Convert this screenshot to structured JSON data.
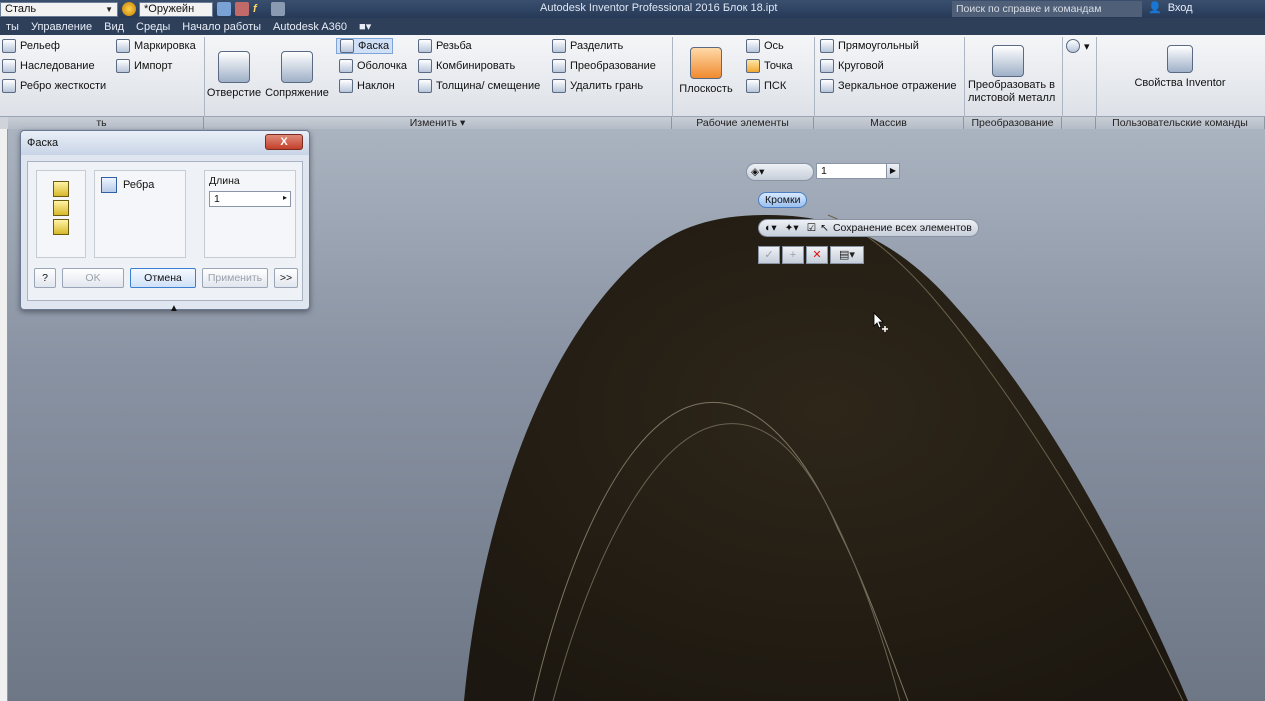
{
  "titlebar": {
    "material": "Сталь",
    "appearance": "*Оружейн",
    "title": "Autodesk Inventor Professional 2016   Блок 18.ipt",
    "help_search": "Поиск по справке и командам",
    "signin": "Вход"
  },
  "menu": {
    "items": [
      "ты",
      "Управление",
      "Вид",
      "Среды",
      "Начало работы",
      "Autodesk A360"
    ]
  },
  "ribbon": {
    "create_col": [
      "Рельеф",
      "Наследование",
      "Ребро жесткости"
    ],
    "create_col2": [
      "Маркировка",
      "Импорт"
    ],
    "hole": "Отверстие",
    "fillet": "Сопряжение",
    "modify_col1": [
      "Фаска",
      "Оболочка",
      "Наклон"
    ],
    "modify_col2": [
      "Резьба",
      "Комбинировать",
      "Толщина/ смещение"
    ],
    "modify_col3": [
      "Разделить",
      "Преобразование",
      "Удалить грань"
    ],
    "plane": "Плоскость",
    "work_col": [
      "Ось",
      "Точка",
      "ПСК"
    ],
    "pattern_col": [
      "Прямоугольный",
      "Круговой",
      "Зеркальное отражение"
    ],
    "convert": "Преобразовать в листовой металл",
    "props": "Свойства Inventor",
    "panels": {
      "left": "ть",
      "modify": "Изменить ▾",
      "work": "Рабочие элементы",
      "pattern": "Массив",
      "convert": "Преобразование",
      "user": "Пользовательские команды"
    }
  },
  "dialog": {
    "title": "Фаска",
    "close": "X",
    "edges_label": "Ребра",
    "length_label": "Длина",
    "length_value": "1",
    "ok": "OK",
    "cancel": "Отмена",
    "apply": "Применить",
    "more": ">>",
    "help": "?"
  },
  "mini": {
    "value": "1",
    "edges_pill": "Кромки",
    "preserve_all": "Сохранение всех элементов"
  },
  "colors": {
    "part": "#2a2218",
    "part_edge": "#3a3222",
    "viewport_top": "#aab3c0",
    "viewport_bottom": "#6e7786"
  }
}
